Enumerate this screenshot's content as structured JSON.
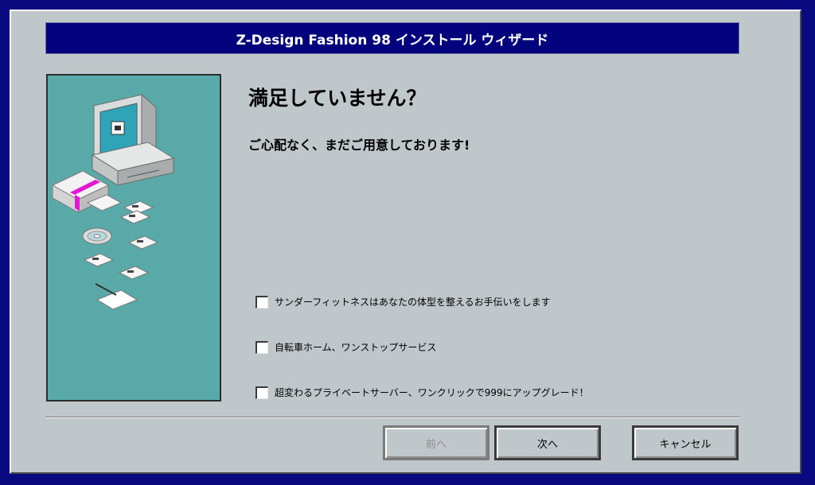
{
  "wizard": {
    "title": "Z-Design Fashion 98 インストール ウィザード",
    "heading": "満足していません？",
    "subheading": "ご心配なく、まだご用意しております!"
  },
  "options": [
    {
      "label": "サンダーフィットネスはあなたの体型を整えるお手伝いをします",
      "checked": false
    },
    {
      "label": "自転車ホーム、ワンストップサービス",
      "checked": false
    },
    {
      "label": "超変わるプライベートサーバー、ワンクリックで999にアップグレード！",
      "checked": false
    }
  ],
  "buttons": {
    "back_label": "前へ",
    "next_label": "次へ",
    "cancel_label": "キャンセル"
  },
  "colors": {
    "desktop": "#0a0a80",
    "titlebar": "#03037e",
    "dialog": "#c0c7cb",
    "side_panel": "#5aa9a9"
  },
  "icons": {
    "illustration": "computer-with-disks-icon"
  }
}
